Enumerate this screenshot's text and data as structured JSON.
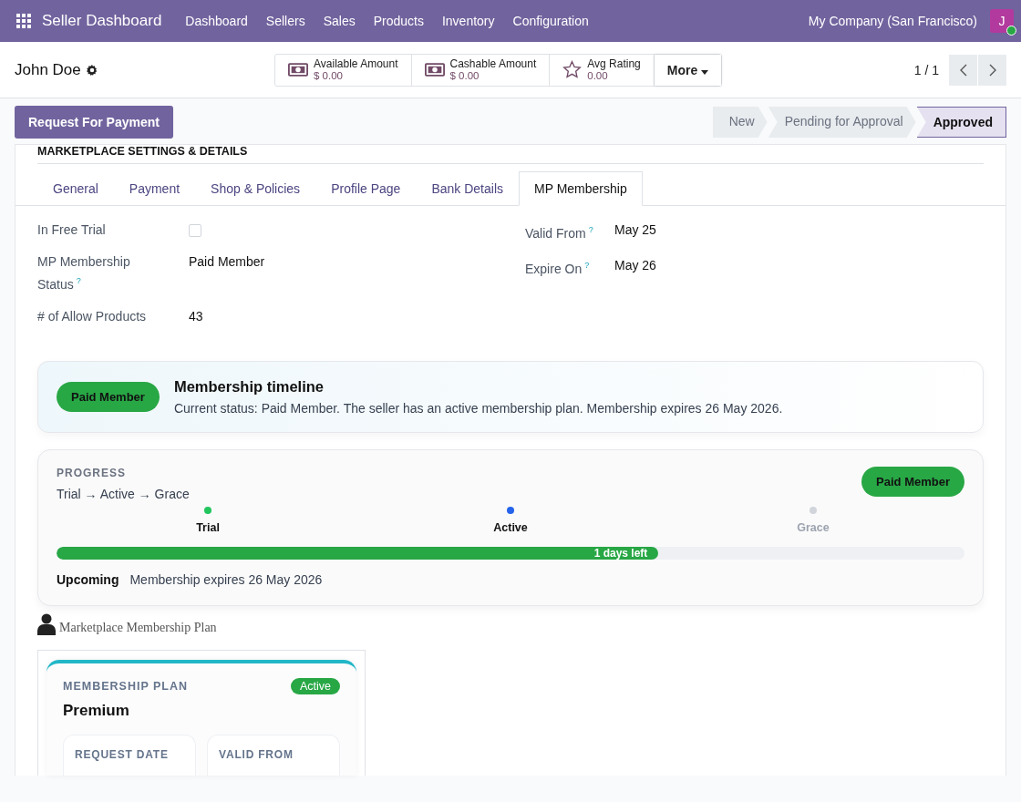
{
  "navbar": {
    "app_name": "Seller Dashboard",
    "menu": [
      "Dashboard",
      "Sellers",
      "Sales",
      "Products",
      "Inventory",
      "Configuration"
    ],
    "company": "My Company (San Francisco)",
    "avatar_letter": "J"
  },
  "control_panel": {
    "record_name": "John Doe",
    "stat_buttons": [
      {
        "kind": "money",
        "label": "Available Amount",
        "value": "$ 0.00"
      },
      {
        "kind": "money",
        "label": "Cashable Amount",
        "value": "$ 0.00"
      },
      {
        "kind": "star",
        "label": "Avg Rating",
        "value": "0.00"
      }
    ],
    "more_button": "More",
    "pager": "1 / 1"
  },
  "action_button": "Request For Payment",
  "stages": [
    {
      "label": "New",
      "selected": false
    },
    {
      "label": "Pending for Approval",
      "selected": false
    },
    {
      "label": "Approved",
      "selected": true
    }
  ],
  "section_title": "MARKETPLACE SETTINGS & DETAILS",
  "tabs": [
    {
      "label": "General",
      "selected": false
    },
    {
      "label": "Payment",
      "selected": false
    },
    {
      "label": "Shop & Policies",
      "selected": false
    },
    {
      "label": "Profile Page",
      "selected": false
    },
    {
      "label": "Bank Details",
      "selected": false
    },
    {
      "label": "MP Membership",
      "selected": true
    }
  ],
  "fields_left": [
    {
      "kind": "checkbox",
      "label": "In Free Trial",
      "help": false,
      "checked": false
    },
    {
      "kind": "text",
      "label": "MP Membership Status",
      "help": true,
      "value": "Paid Member"
    },
    {
      "kind": "text",
      "label": "# of Allow Products",
      "help": false,
      "value": "43"
    }
  ],
  "fields_right": [
    {
      "kind": "text",
      "label": "Valid From",
      "help": true,
      "value": "May 25"
    },
    {
      "kind": "text",
      "label": "Expire On",
      "help": true,
      "value": "May 26"
    }
  ],
  "help_mark": "?",
  "timeline": {
    "badge": "Paid Member",
    "title": "Membership timeline",
    "text": "Current status: Paid Member. The seller has an active membership plan. Membership expires 26 May 2026."
  },
  "progress": {
    "heading": "PROGRESS",
    "path": "Trial → Active → Grace",
    "badge": "Paid Member",
    "steps": [
      {
        "label": "Trial",
        "reached": true,
        "color": "#22c55e"
      },
      {
        "label": "Active",
        "reached": true,
        "color": "#2563eb"
      },
      {
        "label": "Grace",
        "reached": false,
        "color": "#d1d5db"
      }
    ],
    "level": 0.663,
    "bar_label": "1 days left",
    "upcoming_label": "Upcoming",
    "upcoming_text": "Membership expires 26 May 2026"
  },
  "plan_section": {
    "title": "Marketplace Membership Plan",
    "card": {
      "heading": "MEMBERSHIP PLAN",
      "status": "Active",
      "name": "Premium",
      "boxes": [
        "REQUEST DATE",
        "VALID FROM"
      ]
    }
  }
}
